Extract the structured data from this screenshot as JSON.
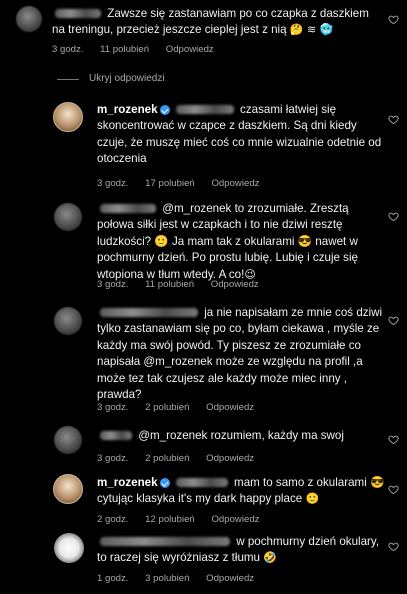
{
  "comments": [
    {
      "text": "Zawsze się zastanawiam po co czapka z daszkiem na treningu, przecież jeszcze cieplej jest z nią",
      "emoji": "🤔 ≋ 🥶",
      "time": "3 godz.",
      "likes": "11 polubień",
      "reply": "Odpowiedz"
    },
    {
      "username": "m_rozenek",
      "text": "czasami łatwiej się skoncentrować w czapce z daszkiem. Są dni kiedy czuje, że muszę mieć coś co mnie wizualnie odetnie od otoczenia",
      "time": "3 godz.",
      "likes": "17 polubień",
      "reply": "Odpowiedz"
    },
    {
      "text": "@m_rozenek to zrozumiałe. Zresztą połowa siłki jest w czapkach i to nie dziwi resztę ludzkości? 🙂 Ja mam tak z okularami 😎 nawet w pochmurny dzień. Po prostu lubię. Lubię i czuje się wtopiona w tłum wtedy. A co!",
      "emoji_end": "😉",
      "time": "3 godz.",
      "likes": "11 polubień",
      "reply": "Odpowiedz"
    },
    {
      "text": "ja nie napisałam ze mnie coś dziwi tylko zastanawiam się po co, byłam ciekawa , myśle ze każdy ma swój powód. Ty piszesz ze zrozumiałe co napisała @m_rozenek może ze względu na profil ,a może tez tak czujesz ale każdy może miec inny , prawda?",
      "time": "3 godz.",
      "likes": "2 polubień",
      "reply": "Odpowiedz"
    },
    {
      "text": "@m_rozenek rozumiem, każdy ma swoj",
      "time": "3 godz.",
      "likes": "2 polubień",
      "reply": "Odpowiedz"
    },
    {
      "username": "m_rozenek",
      "text": "mam to samo z okularami 😎 cytując klasyka it's my dark happy place",
      "emoji_end": "🙂",
      "time": "2 godz.",
      "likes": "12 polubień",
      "reply": "Odpowiedz"
    },
    {
      "text": "w pochmurny dzień okulary, to raczej się wyróżniasz z tłumu",
      "emoji_end": "🤣",
      "time": "1 godz.",
      "likes": "3 polubień",
      "reply": "Odpowiedz"
    }
  ],
  "hidden_replies": "Ukryj odpowiedzi",
  "colors": {
    "background": "#000000",
    "text": "#f5f5f5",
    "meta": "#a8a8a8",
    "verified": "#3897f0"
  },
  "icons": {
    "like": "heart-icon",
    "verified": "verified-badge-icon"
  }
}
